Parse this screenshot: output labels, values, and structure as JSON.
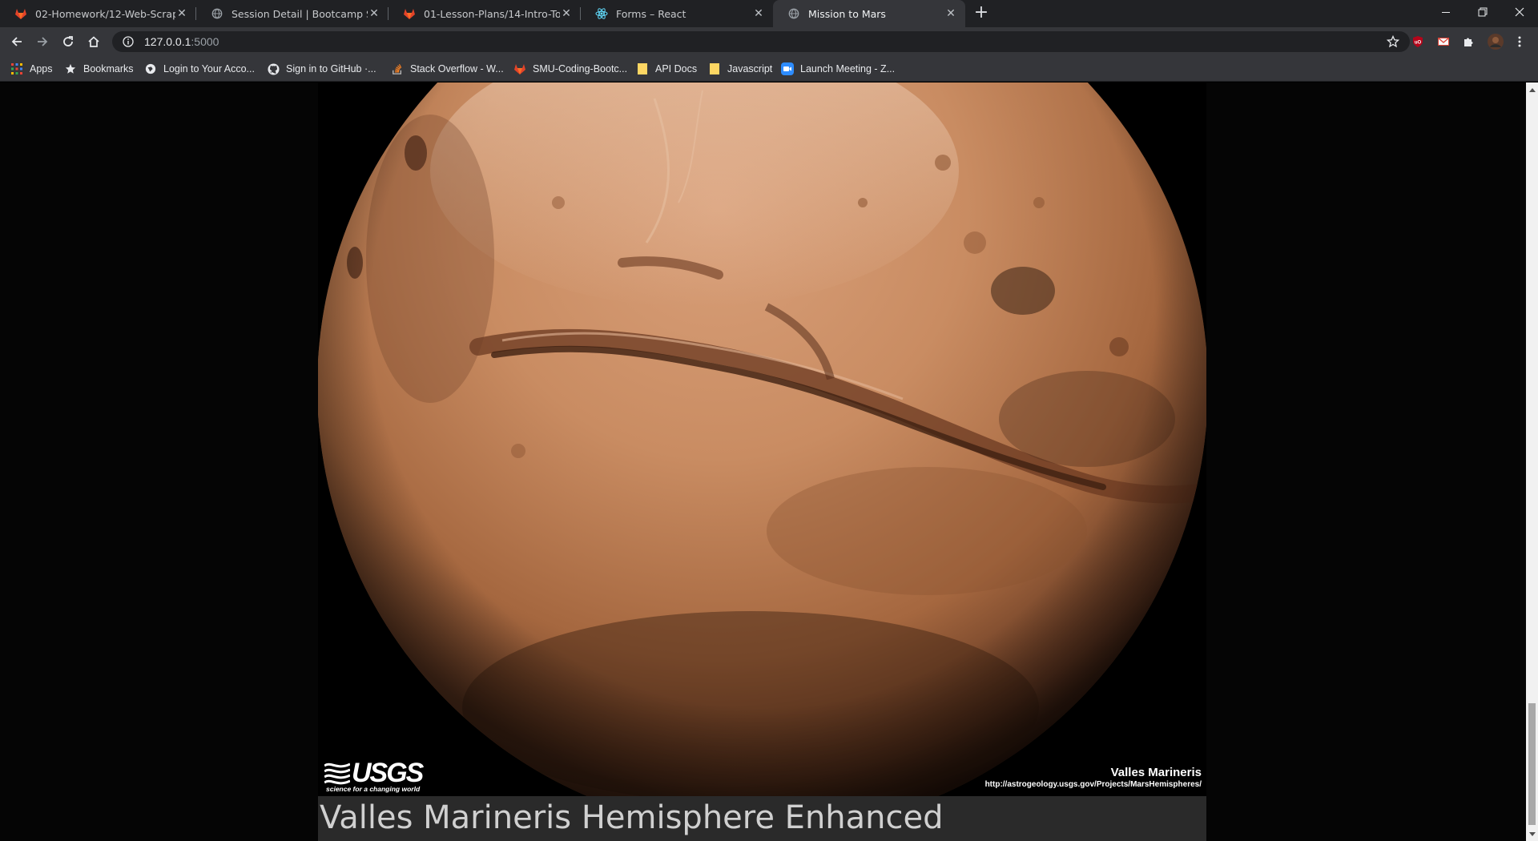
{
  "tabs": [
    {
      "title": "02-Homework/12-Web-Scraping-",
      "icon": "gitlab-icon"
    },
    {
      "title": "Session Detail | Bootcamp Spot",
      "icon": "globe-icon"
    },
    {
      "title": "01-Lesson-Plans/14-Intro-To-Jav",
      "icon": "gitlab-icon"
    },
    {
      "title": "Forms – React",
      "icon": "react-icon"
    },
    {
      "title": "Mission to Mars",
      "icon": "globe-icon",
      "active": true
    }
  ],
  "new_tab_label": "+",
  "address_bar": {
    "host": "127.0.0.1",
    "port": ":5000"
  },
  "bookmarks": [
    {
      "label": "Apps",
      "icon": "apps-grid-icon"
    },
    {
      "label": "Bookmarks",
      "icon": "star-icon"
    },
    {
      "label": "Login to Your Acco...",
      "icon": "globe-icon"
    },
    {
      "label": "Sign in to GitHub ·...",
      "icon": "github-icon"
    },
    {
      "label": "Stack Overflow - W...",
      "icon": "stackoverflow-icon"
    },
    {
      "label": "SMU-Coding-Bootc...",
      "icon": "gitlab-icon"
    },
    {
      "label": "API Docs",
      "icon": "folder-icon"
    },
    {
      "label": "Javascript",
      "icon": "folder-icon"
    },
    {
      "label": "Launch Meeting - Z...",
      "icon": "zoom-icon"
    }
  ],
  "hemisphere": {
    "title": "Valles Marineris Hemisphere Enhanced",
    "image_logo": "USGS",
    "image_logo_tagline": "science for a changing world",
    "image_caption_title": "Valles Marineris",
    "image_caption_url": "http://astrogeology.usgs.gov/Projects/MarsHemispheres/"
  },
  "colors": {
    "tab_strip": "#202124",
    "toolbar": "#35363a",
    "page_background": "#050505",
    "title_bar": "#2a2a2a",
    "mars_surface": "#c78a5f"
  }
}
